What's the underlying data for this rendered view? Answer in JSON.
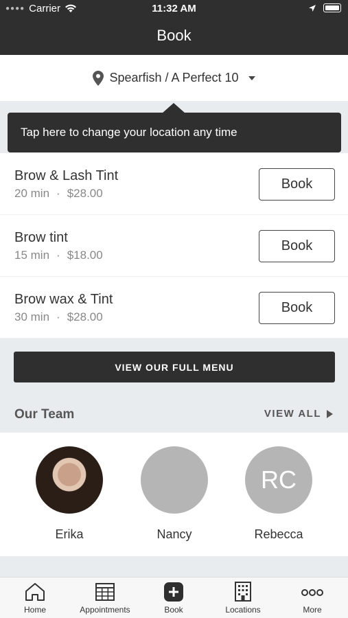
{
  "status_bar": {
    "carrier": "Carrier",
    "time": "11:32 AM"
  },
  "header": {
    "title": "Book"
  },
  "location": {
    "label": "Spearfish / A Perfect 10"
  },
  "tooltip": {
    "text": "Tap here to change your location any time"
  },
  "services": [
    {
      "name": "Brow & Lash Tint",
      "duration": "20 min",
      "price": "$28.00",
      "button": "Book"
    },
    {
      "name": "Brow tint",
      "duration": "15 min",
      "price": "$18.00",
      "button": "Book"
    },
    {
      "name": "Brow wax & Tint",
      "duration": "30 min",
      "price": "$28.00",
      "button": "Book"
    }
  ],
  "separator": "·",
  "menu_button": {
    "label": "VIEW OUR FULL MENU"
  },
  "team": {
    "title": "Our Team",
    "view_all": "VIEW ALL",
    "members": [
      {
        "name": "Erika",
        "avatar": "photo"
      },
      {
        "name": "Nancy",
        "avatar": "blank"
      },
      {
        "name": "Rebecca",
        "initials": "RC"
      }
    ]
  },
  "tabs": [
    {
      "label": "Home",
      "icon": "home-icon"
    },
    {
      "label": "Appointments",
      "icon": "calendar-icon"
    },
    {
      "label": "Book",
      "icon": "plus-icon"
    },
    {
      "label": "Locations",
      "icon": "building-icon"
    },
    {
      "label": "More",
      "icon": "more-icon"
    }
  ],
  "colors": {
    "dark": "#2f2f2f",
    "background": "#e9ecef",
    "avatar_gray": "#b5b5b5"
  }
}
